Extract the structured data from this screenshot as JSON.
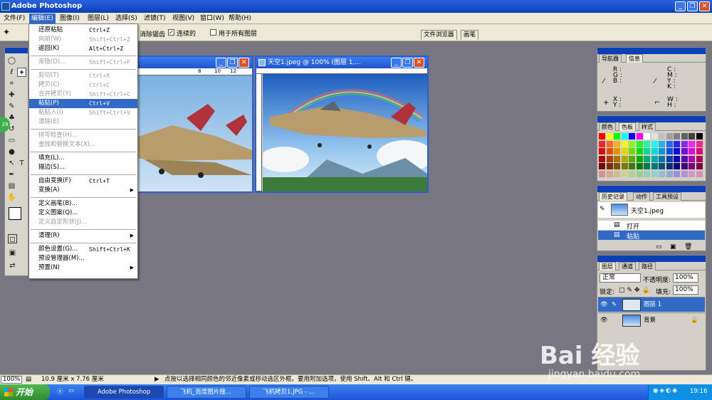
{
  "window": {
    "title": "Adobe Photoshop"
  },
  "menubar": [
    {
      "label": "文件(F)"
    },
    {
      "label": "编辑(E)"
    },
    {
      "label": "图像(I)"
    },
    {
      "label": "图层(L)"
    },
    {
      "label": "选择(S)"
    },
    {
      "label": "滤镜(T)"
    },
    {
      "label": "视图(V)"
    },
    {
      "label": "窗口(W)"
    },
    {
      "label": "帮助(H)"
    }
  ],
  "options": {
    "antialias": "消除锯齿",
    "contiguous": "连续的",
    "all_layers": "用于所有图层",
    "file_browser": "文件浏览器",
    "brushes": "画笔"
  },
  "edit_menu": [
    {
      "label": "还原粘贴",
      "shortcut": "Ctrl+Z",
      "state": "normal"
    },
    {
      "label": "向前(W)",
      "shortcut": "Shift+Ctrl+Z",
      "state": "disabled"
    },
    {
      "label": "返回(K)",
      "shortcut": "Alt+Ctrl+Z",
      "state": "normal"
    },
    {
      "label": "渐隐(D)...",
      "shortcut": "Shift+Ctrl+F",
      "state": "disabled"
    },
    {
      "label": "剪切(T)",
      "shortcut": "Ctrl+X",
      "state": "disabled"
    },
    {
      "label": "拷贝(C)",
      "shortcut": "Ctrl+C",
      "state": "disabled"
    },
    {
      "label": "合并拷贝(Y)",
      "shortcut": "Shift+Ctrl+C",
      "state": "disabled"
    },
    {
      "label": "粘贴(P)",
      "shortcut": "Ctrl+V",
      "state": "highlighted"
    },
    {
      "label": "粘贴入(I)",
      "shortcut": "Shift+Ctrl+V",
      "state": "disabled"
    },
    {
      "label": "清除(E)",
      "shortcut": "",
      "state": "disabled"
    },
    {
      "label": "拼写检查(H)...",
      "shortcut": "",
      "state": "disabled"
    },
    {
      "label": "查找和替换文本(X)...",
      "shortcut": "",
      "state": "disabled"
    },
    {
      "label": "填充(L)...",
      "shortcut": "",
      "state": "normal"
    },
    {
      "label": "描边(S)...",
      "shortcut": "",
      "state": "normal"
    },
    {
      "label": "自由变换(F)",
      "shortcut": "Ctrl+T",
      "state": "normal"
    },
    {
      "label": "变换(A)",
      "shortcut": "",
      "state": "submenu"
    },
    {
      "label": "定义画笔(B)...",
      "shortcut": "",
      "state": "normal"
    },
    {
      "label": "定义图案(Q)...",
      "shortcut": "",
      "state": "normal"
    },
    {
      "label": "定义自定形状(J)...",
      "shortcut": "",
      "state": "disabled"
    },
    {
      "label": "清理(R)",
      "shortcut": "",
      "state": "submenu"
    },
    {
      "label": "颜色设置(G)...",
      "shortcut": "Shift+Ctrl+K",
      "state": "normal"
    },
    {
      "label": "预设管理器(M)...",
      "shortcut": "",
      "state": "normal"
    },
    {
      "label": "预置(N)",
      "shortcut": "",
      "state": "submenu"
    }
  ],
  "doc2": {
    "title": "天空1.jpeg @ 100% (图层 1,..."
  },
  "doc1": {
    "ruler_ticks": [
      "8",
      "10",
      "12"
    ]
  },
  "navigator": {
    "tab_nav": "导航器",
    "tab_info": "信息",
    "r": "R :",
    "g": "G :",
    "b": "B :",
    "c": "C :",
    "m": "M :",
    "y": "Y :",
    "k": "K :",
    "x": "X :",
    "ycoord": "Y :",
    "w": "W :",
    "h": "H :"
  },
  "swatches_panel": {
    "tab_color": "颜色",
    "tab_swatches": "色板",
    "tab_styles": "样式"
  },
  "history": {
    "tab_history": "历史记录",
    "tab_actions": "动作",
    "tab_presets": "工具预设",
    "snapshot": "天空1.jpeg",
    "steps": [
      "打开",
      "粘贴"
    ]
  },
  "layers": {
    "tab_layers": "图层",
    "tab_channels": "通道",
    "tab_paths": "路径",
    "blend": "正常",
    "opacity_label": "不透明度:",
    "opacity": "100%",
    "lock_label": "锁定:",
    "fill_label": "填充:",
    "fill": "100%",
    "items": [
      "图层 1",
      "背景"
    ]
  },
  "status": {
    "zoom": "100%",
    "size": "10.9 厘米 x 7.76 厘米",
    "hint": "点按以选择相同颜色的邻近像素或移动选区外框。要用附加选项，使用 Shift、Alt 和 Ctrl 键。"
  },
  "taskbar": {
    "start": "开始",
    "tasks": [
      "Adobe Photoshop",
      "飞机_百度图片搜...",
      "飞机拷贝1.JPG - ..."
    ],
    "clock": "19:16"
  },
  "watermark": {
    "brand": "Bai 经验",
    "url": "jingyan.baidu.com"
  },
  "colors": {
    "title_blue": "#0a3fb8",
    "highlight": "#316ac5",
    "canvas_bg": "#787680"
  }
}
